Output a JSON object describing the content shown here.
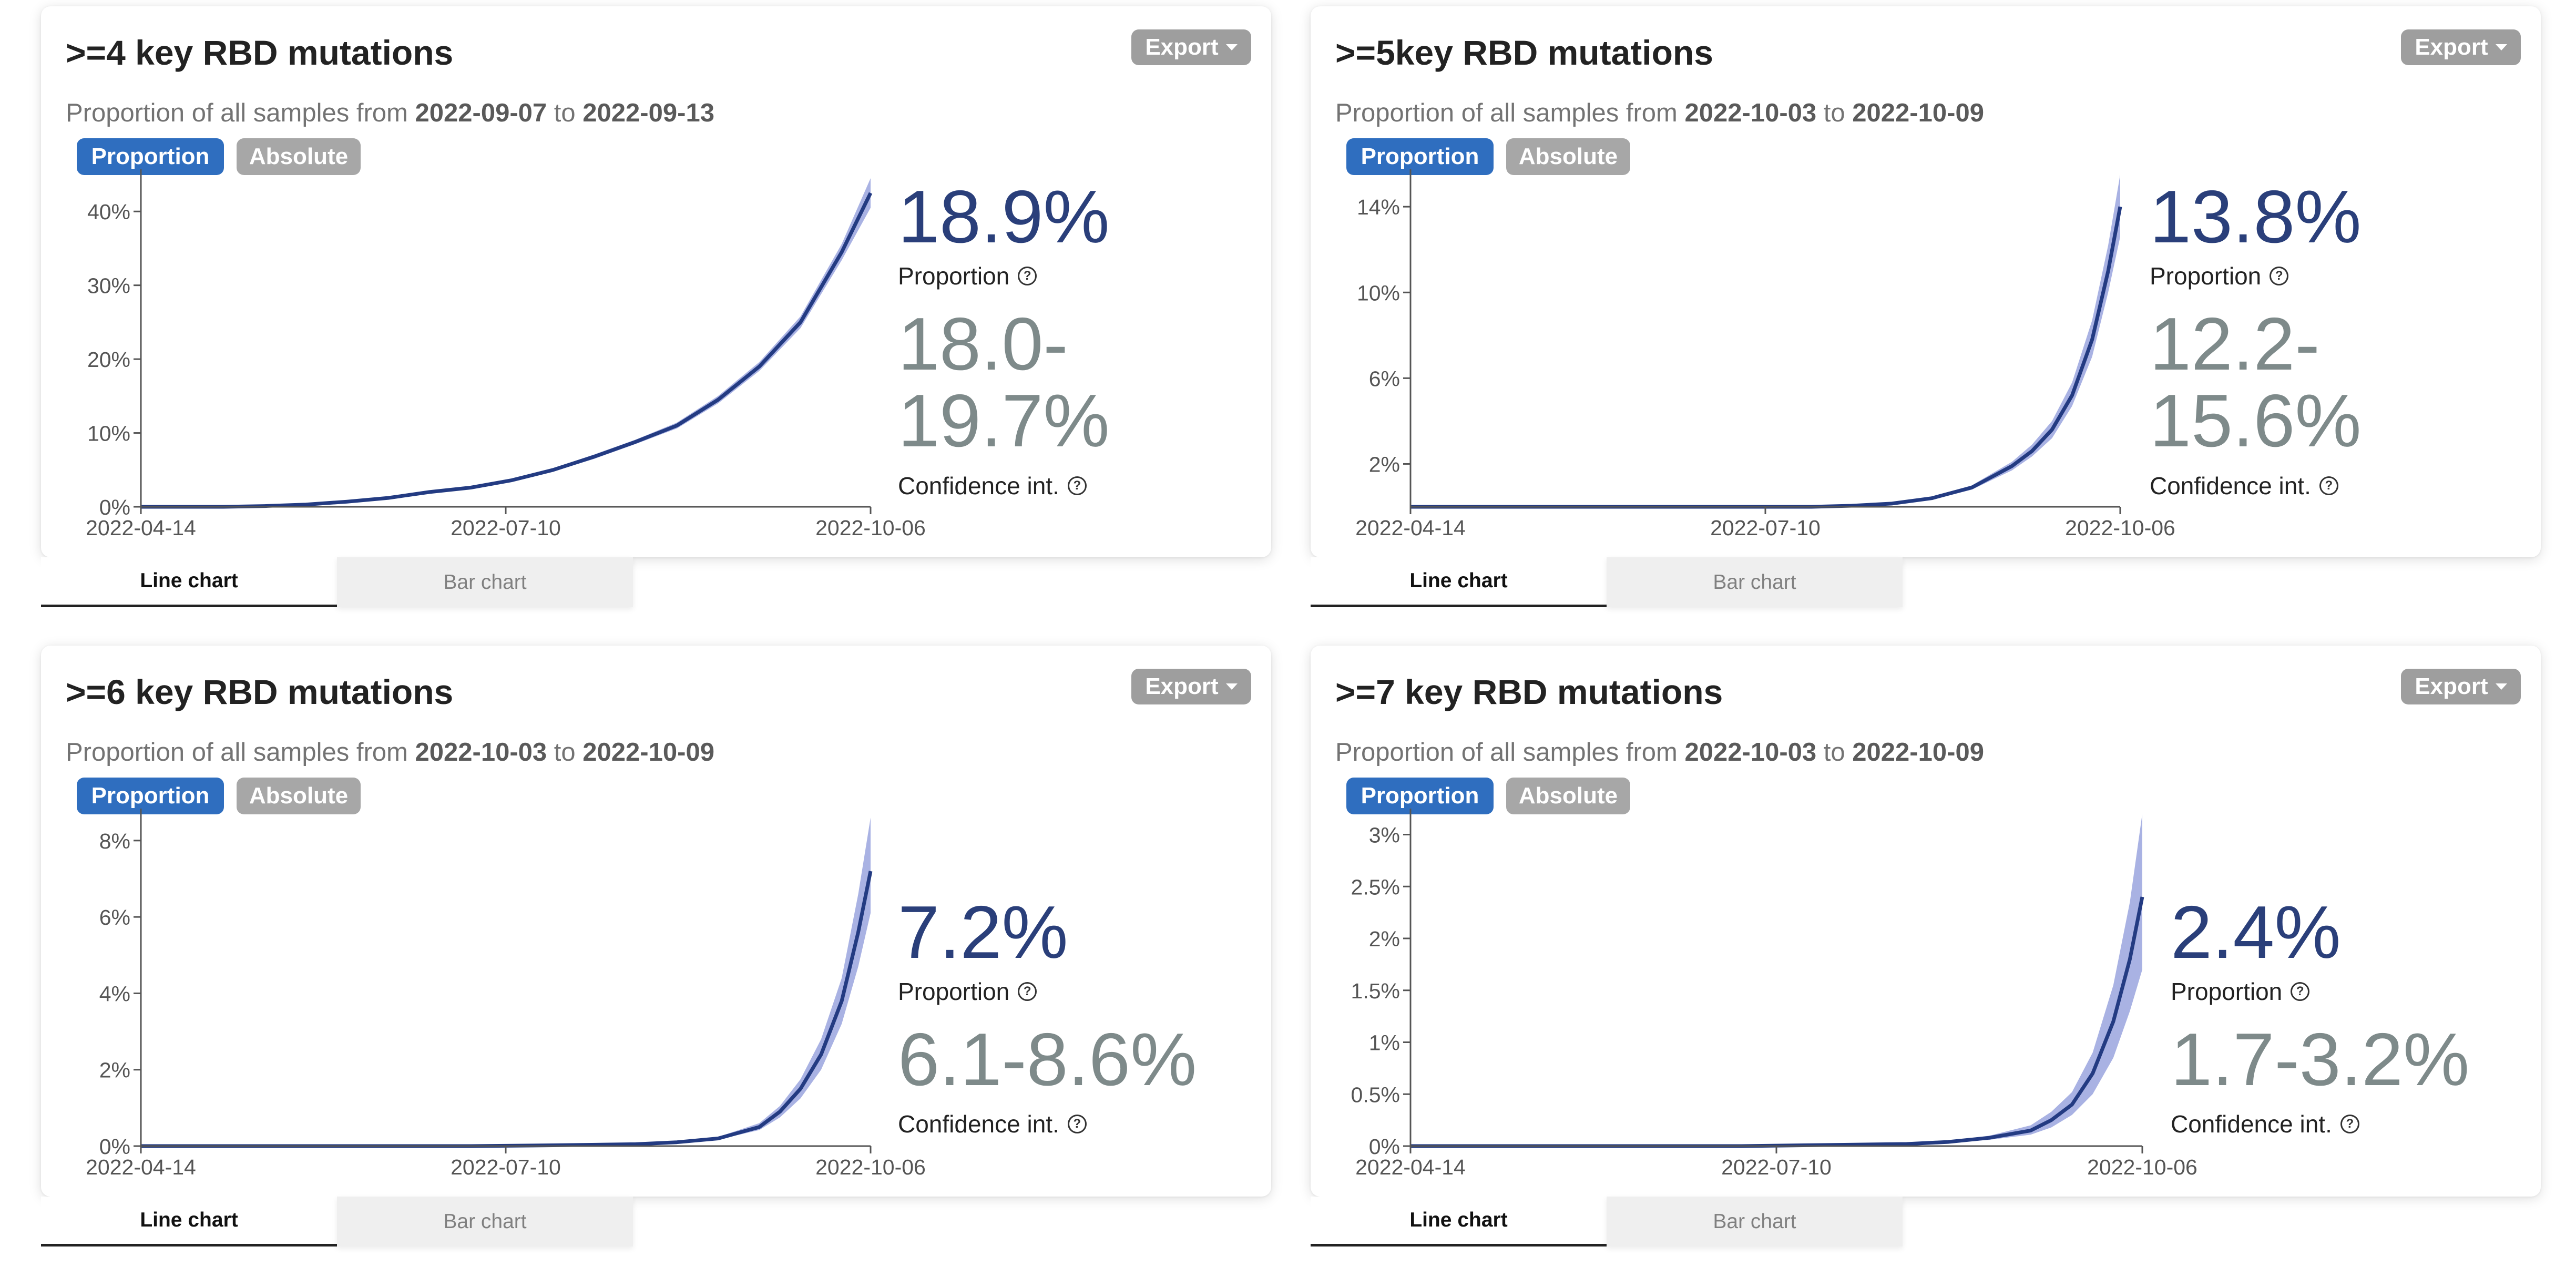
{
  "colors": {
    "line": "#233b82",
    "band": "#9aa5de",
    "axis": "#555555",
    "proportion_value": "#2a3f7a",
    "ci_value": "#7e8a8a",
    "active_toggle": "#2f6ebf",
    "inactive_toggle": "#a7a7a7",
    "export_button": "#9e9e9e"
  },
  "panels": [
    {
      "title": ">=4 key RBD mutations",
      "subtitle_prefix": "Proportion of all samples from",
      "date_from": "2022-09-07",
      "subtitle_mid": "to",
      "date_to": "2022-09-13",
      "export_label": "Export",
      "toggle_active": "Proportion",
      "toggle_inactive": "Absolute",
      "proportion": "18.9%",
      "proportion_label": "Proportion",
      "ci_line1": "18.0-",
      "ci_line2": "19.7%",
      "ci_label": "Confidence int.",
      "help_icon": "?",
      "tab_line": "Line chart",
      "tab_bar": "Bar chart",
      "chart_data": {
        "type": "line",
        "x_ticks": [
          "2022-04-14",
          "2022-07-10",
          "2022-10-06"
        ],
        "y_ticks": [
          "0%",
          "10%",
          "20%",
          "30%",
          "40%"
        ],
        "ylim": [
          0,
          45
        ],
        "xlabel": "",
        "ylabel": "",
        "x_days": [
          0,
          10,
          20,
          30,
          40,
          50,
          60,
          70,
          80,
          90,
          100,
          110,
          120,
          130,
          140,
          150,
          160,
          170,
          177
        ],
        "y": [
          0,
          0,
          0,
          0.1,
          0.3,
          0.7,
          1.2,
          2.0,
          2.6,
          3.6,
          5.0,
          6.8,
          8.8,
          11.0,
          14.5,
          19.0,
          25.0,
          34.5,
          42.5
        ],
        "ci_low": [
          0,
          0,
          0,
          0.1,
          0.25,
          0.6,
          1.1,
          1.85,
          2.45,
          3.4,
          4.8,
          6.5,
          8.5,
          10.6,
          14.0,
          18.4,
          24.2,
          33.4,
          40.5
        ],
        "ci_high": [
          0,
          0,
          0,
          0.1,
          0.35,
          0.8,
          1.3,
          2.15,
          2.75,
          3.8,
          5.2,
          7.1,
          9.1,
          11.4,
          15.0,
          19.6,
          25.8,
          35.6,
          44.5
        ]
      }
    },
    {
      "title": ">=5key RBD mutations",
      "subtitle_prefix": "Proportion of all samples from",
      "date_from": "2022-10-03",
      "subtitle_mid": "to",
      "date_to": "2022-10-09",
      "export_label": "Export",
      "toggle_active": "Proportion",
      "toggle_inactive": "Absolute",
      "proportion": "13.8%",
      "proportion_label": "Proportion",
      "ci_line1": "12.2-",
      "ci_line2": "15.6%",
      "ci_label": "Confidence int.",
      "help_icon": "?",
      "tab_line": "Line chart",
      "tab_bar": "Bar chart",
      "chart_data": {
        "type": "line",
        "x_ticks": [
          "2022-04-14",
          "2022-07-10",
          "2022-10-06"
        ],
        "y_ticks": [
          "2%",
          "6%",
          "10%",
          "14%"
        ],
        "ylim": [
          0,
          15.5
        ],
        "xlabel": "",
        "ylabel": "",
        "x_days": [
          0,
          20,
          40,
          60,
          80,
          100,
          110,
          120,
          130,
          140,
          145,
          150,
          155,
          160,
          165,
          170,
          174,
          177
        ],
        "y": [
          0,
          0,
          0,
          0,
          0,
          0,
          0.05,
          0.15,
          0.4,
          0.9,
          1.4,
          1.9,
          2.6,
          3.6,
          5.2,
          7.8,
          11.0,
          14.0
        ],
        "ci_low": [
          0,
          0,
          0,
          0,
          0,
          0,
          0.05,
          0.12,
          0.33,
          0.8,
          1.25,
          1.7,
          2.35,
          3.2,
          4.7,
          7.0,
          10.0,
          12.6
        ],
        "ci_high": [
          0,
          0,
          0,
          0,
          0,
          0,
          0.05,
          0.18,
          0.47,
          1.0,
          1.55,
          2.1,
          2.9,
          4.0,
          5.8,
          8.7,
          12.2,
          15.5
        ]
      }
    },
    {
      "title": ">=6 key RBD mutations",
      "subtitle_prefix": "Proportion of all samples from",
      "date_from": "2022-10-03",
      "subtitle_mid": "to",
      "date_to": "2022-10-09",
      "export_label": "Export",
      "toggle_active": "Proportion",
      "toggle_inactive": "Absolute",
      "proportion": "7.2%",
      "proportion_label": "Proportion",
      "ci_single": "6.1-8.6%",
      "ci_label": "Confidence int.",
      "help_icon": "?",
      "tab_line": "Line chart",
      "tab_bar": "Bar chart",
      "chart_data": {
        "type": "line",
        "x_ticks": [
          "2022-04-14",
          "2022-07-10",
          "2022-10-06"
        ],
        "y_ticks": [
          "0%",
          "2%",
          "4%",
          "6%",
          "8%"
        ],
        "ylim": [
          0,
          8.7
        ],
        "xlabel": "",
        "ylabel": "",
        "x_days": [
          0,
          40,
          80,
          100,
          120,
          130,
          140,
          150,
          155,
          160,
          165,
          170,
          174,
          177
        ],
        "y": [
          0,
          0,
          0,
          0.02,
          0.05,
          0.1,
          0.2,
          0.5,
          0.9,
          1.5,
          2.4,
          3.8,
          5.6,
          7.2
        ],
        "ci_low": [
          0,
          0,
          0,
          0.02,
          0.04,
          0.08,
          0.17,
          0.42,
          0.75,
          1.25,
          2.0,
          3.2,
          4.7,
          6.1
        ],
        "ci_high": [
          0,
          0,
          0,
          0.02,
          0.06,
          0.12,
          0.24,
          0.6,
          1.05,
          1.75,
          2.8,
          4.4,
          6.6,
          8.6
        ]
      }
    },
    {
      "title": ">=7 key RBD mutations",
      "subtitle_prefix": "Proportion of all samples from",
      "date_from": "2022-10-03",
      "subtitle_mid": "to",
      "date_to": "2022-10-09",
      "export_label": "Export",
      "toggle_active": "Proportion",
      "toggle_inactive": "Absolute",
      "proportion": "2.4%",
      "proportion_label": "Proportion",
      "ci_single": "1.7-3.2%",
      "ci_label": "Confidence int.",
      "help_icon": "?",
      "tab_line": "Line chart",
      "tab_bar": "Bar chart",
      "chart_data": {
        "type": "line",
        "x_ticks": [
          "2022-04-14",
          "2022-07-10",
          "2022-10-06"
        ],
        "y_ticks": [
          "0%",
          "0.5%",
          "1%",
          "1.5%",
          "2%",
          "2.5%",
          "3%"
        ],
        "ylim": [
          0,
          3.2
        ],
        "xlabel": "",
        "ylabel": "",
        "x_days": [
          0,
          40,
          80,
          100,
          120,
          130,
          140,
          150,
          155,
          160,
          165,
          170,
          174,
          177
        ],
        "y": [
          0,
          0,
          0,
          0.01,
          0.02,
          0.04,
          0.08,
          0.15,
          0.25,
          0.4,
          0.7,
          1.2,
          1.8,
          2.4
        ],
        "ci_low": [
          0,
          0,
          0,
          0.01,
          0.015,
          0.03,
          0.06,
          0.11,
          0.18,
          0.3,
          0.5,
          0.85,
          1.3,
          1.7
        ],
        "ci_high": [
          0,
          0,
          0,
          0.01,
          0.025,
          0.05,
          0.1,
          0.2,
          0.33,
          0.52,
          0.9,
          1.55,
          2.35,
          3.2
        ]
      }
    }
  ]
}
